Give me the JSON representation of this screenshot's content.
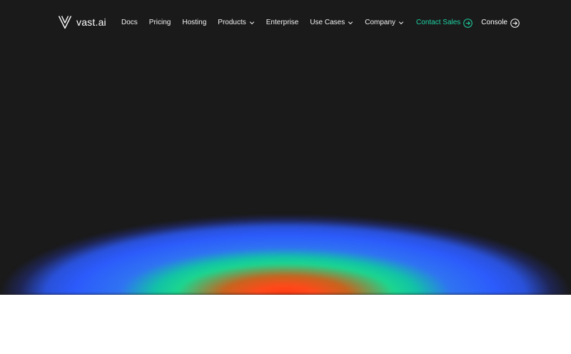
{
  "brand": {
    "name": "vast.ai",
    "logo_icon": "vast-logo-icon"
  },
  "nav": {
    "items": [
      {
        "label": "Docs",
        "has_dropdown": false
      },
      {
        "label": "Pricing",
        "has_dropdown": false
      },
      {
        "label": "Hosting",
        "has_dropdown": false
      },
      {
        "label": "Products",
        "has_dropdown": true
      },
      {
        "label": "Enterprise",
        "has_dropdown": false
      },
      {
        "label": "Use Cases",
        "has_dropdown": true
      },
      {
        "label": "Company",
        "has_dropdown": true
      }
    ],
    "contact_sales": "Contact Sales",
    "console": "Console"
  },
  "colors": {
    "background": "#1a1a1a",
    "accent": "#1ed3a4",
    "text": "#ffffff",
    "glow_blue": "#2c5bfc",
    "glow_green": "#1bd68f",
    "glow_red": "#ff3a12"
  }
}
